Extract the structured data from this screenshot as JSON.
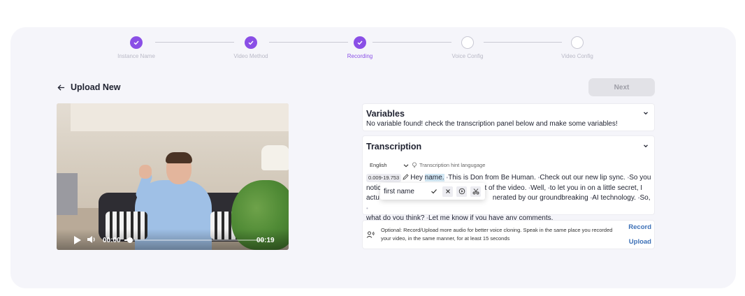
{
  "stepper": {
    "steps": [
      {
        "label": "Instance Name",
        "status": "done"
      },
      {
        "label": "Video Method",
        "status": "done"
      },
      {
        "label": "Recording",
        "status": "current-done"
      },
      {
        "label": "Voice Config",
        "status": "todo"
      },
      {
        "label": "Video Config",
        "status": "todo"
      }
    ],
    "accent_color": "#8a4fe6"
  },
  "header": {
    "title": "Upload New",
    "next_label": "Next",
    "next_disabled": true
  },
  "video": {
    "current_time": "00:00",
    "duration": "00:19",
    "progress": 0.04
  },
  "variables": {
    "title": "Variables",
    "message": "No variable found! check the transcription panel below and make some variables!"
  },
  "transcription": {
    "title": "Transcription",
    "language": "English",
    "hint_label": "Transcription hint langugage",
    "timestamp": "0.009-19.753",
    "segments": {
      "s1_pre": "Hey ",
      "s1_hl": "name.",
      "s2": "This is Don from Be Human.",
      "s3": "Check out our new lip sync.",
      "s4": "So you",
      "line2_a": "notic",
      "line2_b": "rt of the video.",
      "s5": "Well,",
      "s6": "to let you in on a little secret, I",
      "line3_a": "actu",
      "line3_b": "nerated by our groundbreaking",
      "s7": "AI technology.",
      "s8": "So,",
      "s9": "what do you think?",
      "s10": "Let me know if you have any comments."
    },
    "popup": {
      "input_value": "first name"
    }
  },
  "recording": {
    "text": "Optional: Record/Upload more audio for better voice cloning. Speak in the same place you recorded your video, in the same manner, for at least 15 seconds",
    "record_label": "Record",
    "upload_label": "Upload",
    "link_color": "#3b6fb6"
  }
}
